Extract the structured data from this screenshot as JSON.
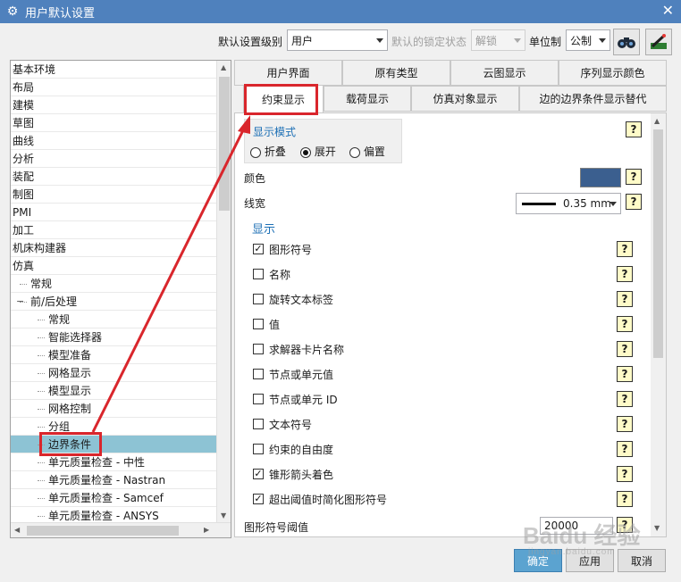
{
  "window": {
    "title": "用户默认设置",
    "close_glyph": "✕",
    "gear_glyph": "⚙"
  },
  "toolbar": {
    "level_label": "默认设置级别",
    "level_value": "用户",
    "lock_label": "默认的锁定状态",
    "lock_value": "解锁",
    "unit_label": "单位制",
    "unit_value": "公制"
  },
  "tree": {
    "items": [
      {
        "label": "基本环境"
      },
      {
        "label": "布局"
      },
      {
        "label": "建模"
      },
      {
        "label": "草图"
      },
      {
        "label": "曲线"
      },
      {
        "label": "分析"
      },
      {
        "label": "装配"
      },
      {
        "label": "制图"
      },
      {
        "label": "PMI"
      },
      {
        "label": "加工"
      },
      {
        "label": "机床构建器"
      },
      {
        "label": "仿真"
      },
      {
        "label": "常规"
      },
      {
        "label": "前/后处理",
        "expander": "−"
      },
      {
        "label": "常规"
      },
      {
        "label": "智能选择器"
      },
      {
        "label": "模型准备"
      },
      {
        "label": "网格显示"
      },
      {
        "label": "模型显示"
      },
      {
        "label": "网格控制"
      },
      {
        "label": "分组"
      },
      {
        "label": "边界条件"
      },
      {
        "label": "单元质量检查 - 中性"
      },
      {
        "label": "单元质量检查 - Nastran"
      },
      {
        "label": "单元质量检查 - Samcef"
      },
      {
        "label": "单元质量检查 - ANSYS"
      }
    ],
    "selected_index": 21
  },
  "tabs_row1": [
    {
      "label": "用户界面"
    },
    {
      "label": "原有类型"
    },
    {
      "label": "云图显示"
    },
    {
      "label": "序列显示颜色"
    }
  ],
  "tabs_row2": [
    {
      "label": "约束显示"
    },
    {
      "label": "载荷显示"
    },
    {
      "label": "仿真对象显示"
    },
    {
      "label": "边的边界条件显示替代"
    }
  ],
  "panel": {
    "mode_title": "显示模式",
    "modes": [
      {
        "label": "折叠",
        "selected": false
      },
      {
        "label": "展开",
        "selected": true
      },
      {
        "label": "偏置",
        "selected": false
      }
    ],
    "color_label": "颜色",
    "color_value": "#3b5f8f",
    "linewidth_label": "线宽",
    "linewidth_value": "0.35 mm",
    "display_title": "显示",
    "options": [
      {
        "label": "图形符号",
        "checked": true
      },
      {
        "label": "名称",
        "checked": false
      },
      {
        "label": "旋转文本标签",
        "checked": false
      },
      {
        "label": "值",
        "checked": false
      },
      {
        "label": "求解器卡片名称",
        "checked": false
      },
      {
        "label": "节点或单元值",
        "checked": false
      },
      {
        "label": "节点或单元 ID",
        "checked": false
      },
      {
        "label": "文本符号",
        "checked": false
      },
      {
        "label": "约束的自由度",
        "checked": false
      },
      {
        "label": "锥形箭头着色",
        "checked": true
      },
      {
        "label": "超出阈值时简化图形符号",
        "checked": true
      }
    ],
    "threshold_label": "图形符号阈值",
    "threshold_value": "20000",
    "help_glyph": "?"
  },
  "buttons": {
    "ok": "确定",
    "apply": "应用",
    "cancel": "取消"
  },
  "watermark": {
    "main": "Baidu 经验",
    "sub": "jingyan.baidu.com"
  },
  "colors": {
    "titlebar": "#4f81bd",
    "selection": "#8dc3d4",
    "accent_text": "#1c6fb5",
    "highlight": "#d9262c"
  }
}
